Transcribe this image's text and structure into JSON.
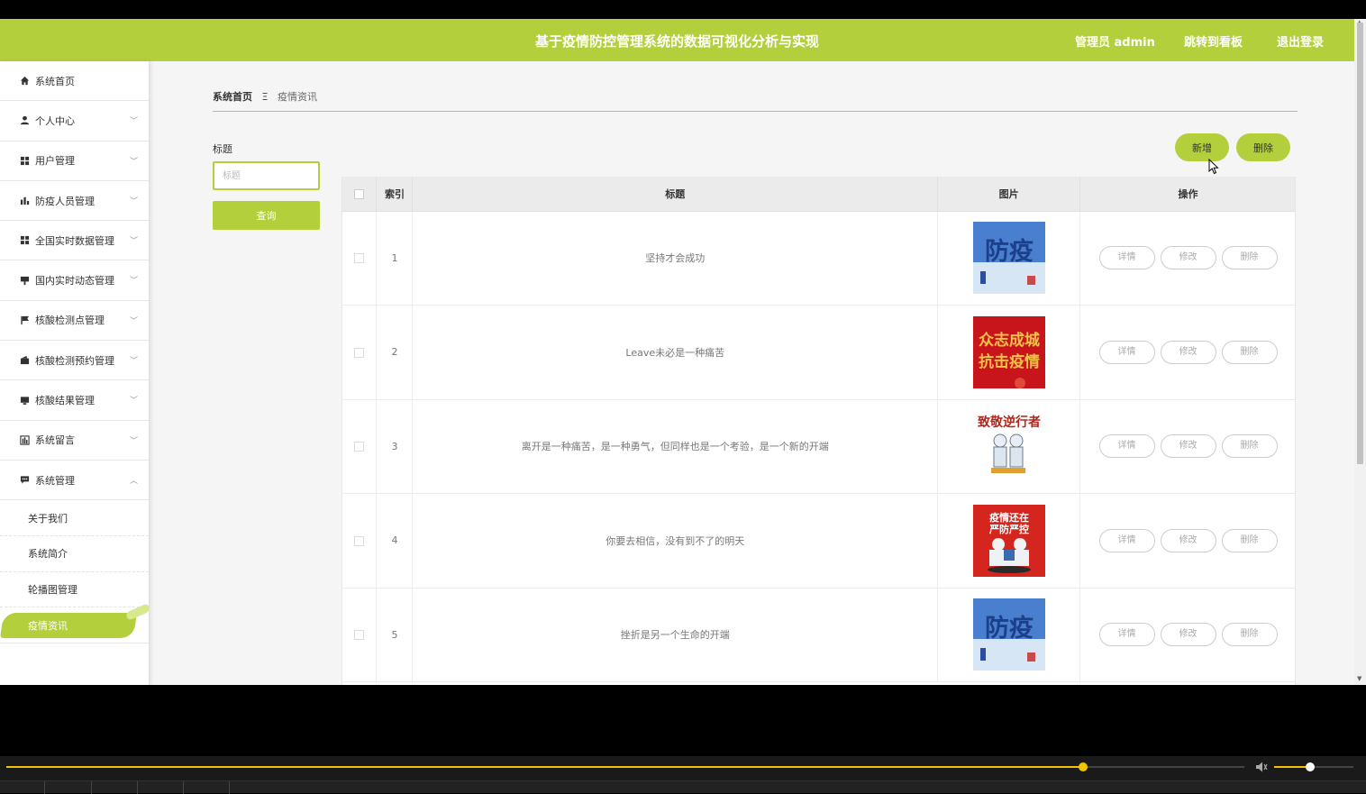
{
  "header": {
    "title": "基于疫情防控管理系统的数据可视化分析与实现",
    "admin_label": "管理员 admin",
    "board_link": "跳转到看板",
    "logout_link": "退出登录",
    "accent_color": "#b3cf3c"
  },
  "sidebar": {
    "items": [
      {
        "label": "系统首页",
        "icon": "home-icon"
      },
      {
        "label": "个人中心",
        "icon": "user-icon"
      },
      {
        "label": "用户管理",
        "icon": "grid-icon"
      },
      {
        "label": "防疫人员管理",
        "icon": "bar-chart-icon"
      },
      {
        "label": "全国实时数据管理",
        "icon": "grid-icon"
      },
      {
        "label": "国内实时动态管理",
        "icon": "sign-icon"
      },
      {
        "label": "核酸检测点管理",
        "icon": "flag-icon"
      },
      {
        "label": "核酸检测预约管理",
        "icon": "wallet-icon"
      },
      {
        "label": "核酸结果管理",
        "icon": "monitor-icon"
      },
      {
        "label": "系统留言",
        "icon": "chart-box-icon"
      },
      {
        "label": "系统管理",
        "icon": "chat-icon"
      }
    ],
    "sub_items": [
      {
        "label": "关于我们"
      },
      {
        "label": "系统简介"
      },
      {
        "label": "轮播图管理"
      },
      {
        "label": "疫情资讯",
        "active": true
      }
    ]
  },
  "breadcrumb": {
    "home": "系统首页",
    "current": "疫情资讯"
  },
  "search": {
    "label": "标题",
    "placeholder": "标题",
    "button": "查询"
  },
  "actions": {
    "add": "新增",
    "delete": "删除"
  },
  "table": {
    "headers": [
      "索引",
      "标题",
      "图片",
      "操作"
    ],
    "op_labels": {
      "detail": "详情",
      "edit": "修改",
      "delete": "删除"
    },
    "rows": [
      {
        "index": "1",
        "title": "坚持才会成功",
        "image": "fangyi-poster"
      },
      {
        "index": "2",
        "title": "Leave未必是一种痛苦",
        "image": "red-calligraphy-poster"
      },
      {
        "index": "3",
        "title": "离开是一种痛苦，是一种勇气，但同样也是一个考验，是一个新的开端",
        "image": "zhijing-nixingzhe-poster"
      },
      {
        "index": "4",
        "title": "你要去相信，没有到不了的明天",
        "image": "yiqing-haizai-poster"
      },
      {
        "index": "5",
        "title": "挫折是另一个生命的开端",
        "image": "fangyi-poster"
      }
    ],
    "image_captions": {
      "fangyi": "防疫",
      "red_line1": "众志成城",
      "red_line2": "抗击疫情",
      "zhijing": "致敬逆行者",
      "yiqing1": "疫情还在",
      "yiqing2": "严防严控"
    }
  },
  "player": {
    "progress": 0.87,
    "volume": 0.45,
    "accent": "#f2c300"
  }
}
